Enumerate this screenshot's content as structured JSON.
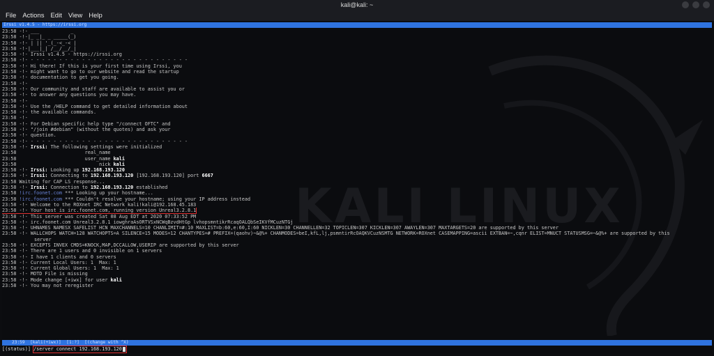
{
  "window": {
    "title": "kali@kali: ~"
  },
  "menu": {
    "file": "File",
    "actions": "Actions",
    "edit": "Edit",
    "view": "View",
    "help": "Help"
  },
  "topbar": {
    "text": "Irssi v1.4.5 - https://irssi.org"
  },
  "watermark": "KALI LINUX",
  "log": [
    {
      "t": "23:58 -!- ___           _"
    },
    {
      "t": "23:58 -!-|_ _|_ _ _____(_)"
    },
    {
      "t": "23:58 -!- | || '_(_-<_-< |"
    },
    {
      "t": "23:58 -!-|___|_| /__/__/_|"
    },
    {
      "t": "23:58 -!- Irssi v1.4.5 - https://irssi.org"
    },
    {
      "t": "23:58 -!- - - - - - - - - - - - - - - - - - - - - - - - - - - - -"
    },
    {
      "t": "23:58 -!- Hi there! If this is your first time using Irssi, you"
    },
    {
      "t": "23:58 -!- might want to go to our website and read the startup"
    },
    {
      "t": "23:58 -!- documentation to get you going."
    },
    {
      "t": "23:58 -!-"
    },
    {
      "t": "23:58 -!- Our community and staff are available to assist you or"
    },
    {
      "t": "23:58 -!- to answer any questions you may have."
    },
    {
      "t": "23:58 -!-"
    },
    {
      "t": "23:58 -!- Use the /HELP command to get detailed information about"
    },
    {
      "t": "23:58 -!- the available commands."
    },
    {
      "t": "23:58 -!-"
    },
    {
      "t": "23:58 -!- For Debian specific help type \"/connect OFTC\" and"
    },
    {
      "t": "23:58 -!- \"/join #debian\" (without the quotes) and ask your"
    },
    {
      "t": "23:58 -!- question."
    },
    {
      "t": "23:58 -!- - - - - - - - - - - - - - - - - - - - - - - - - - - - -"
    },
    {
      "p": "23:58 -!- ",
      "b": "Irssi:",
      "s": " The following settings were initialized"
    },
    {
      "t": "23:58                        real_name"
    },
    {
      "p": "23:58                        user_name ",
      "b": "kali",
      "s": ""
    },
    {
      "p": "23:58                             nick ",
      "b": "kali",
      "s": ""
    },
    {
      "p": "23:58 -!- ",
      "b": "Irssi:",
      "s": " Looking up ",
      "b2": "192.168.193.120",
      "s2": ""
    },
    {
      "p": "23:58 -!- ",
      "b": "Irssi:",
      "s": " Connecting to ",
      "b2": "192.168.193.120",
      "s2": " [192.168.193.120] port ",
      "b3": "6667"
    },
    {
      "t": "23:58 Waiting for CAP LS response..."
    },
    {
      "p": "23:58 -!- ",
      "b": "Irssi:",
      "s": " Connection to ",
      "b2": "192.168.193.120",
      "s2": " established"
    },
    {
      "p": "23:58 ",
      "blue": "!irc.foonet.com",
      "s": " *** Looking up your hostname..."
    },
    {
      "p": "23:58 ",
      "blue": "!irc.foonet.com",
      "s": " *** Couldn't resolve your hostname; using your IP address instead"
    },
    {
      "t": "23:58 -!- Welcome to the ROXnet IRC Network kali!kali@192.168.45.183"
    },
    {
      "t": "23:58 -!- Your host is irc.foonet.com, running version Unreal3.2.8.1",
      "hl": true
    },
    {
      "t": "23:58 -!- This server was created Sat 08 Aug EDT at 2020 07:33:52 PM"
    },
    {
      "t": "23:58 -!- irc.foonet.com Unreal3.2.8.1 iowghraAsORTVSxNCWqBzvdHtGp lvhopsmntikrRcaqOALQbSeIKVfMCuzNTGj"
    },
    {
      "t": "23:58 -!- UHNAMES NAMESX SAFELIST HCN MAXCHANNELS=10 CHANLIMIT=#:10 MAXLIST=b:60,e:60,I:60 NICKLEN=30 CHANNELLEN=32 TOPICLEN=307 KICKLEN=307 AWAYLEN=307 MAXTARGETS=20 are supported by this server"
    },
    {
      "t": "23:58 -!- WALLCHOPS WATCH=128 WATCHOPTS=A SILENCE=15 MODES=12 CHANTYPES=# PREFIX=(qaohv)~&@%+ CHANMODES=beI,kfL,lj,psmntirRcOAQKVCuzNSMTG NETWORK=ROXnet CASEMAPPING=ascii EXTBAN=~,cqnr ELIST=MNUCT STATUSMSG=~&@%+ are supported by this"
    },
    {
      "t": "server",
      "wrap": true
    },
    {
      "t": "23:58 -!- EXCEPTS INVEX CMDS=KNOCK,MAP,DCCALLOW,USERIP are supported by this server"
    },
    {
      "t": "23:58 -!- There are 1 users and 0 invisible on 1 servers"
    },
    {
      "t": "23:58 -!- I have 1 clients and 0 servers"
    },
    {
      "t": "23:58 -!- Current Local Users: 1  Max: 1"
    },
    {
      "t": "23:58 -!- Current Global Users: 1  Max: 1"
    },
    {
      "t": "23:58 -!- MOTD File is missing"
    },
    {
      "p": "23:58 -!- Mode change [+iwx] for user ",
      "b": "kali",
      "s": ""
    },
    {
      "t": "23:58 -!- You may not reregister"
    }
  ],
  "statusbar": {
    "text": "23:59  [kali(+iwx)]  [1:?]  [(change with ^X)"
  },
  "input": {
    "prompt": "[(status)] ",
    "value": "/server connect 192.168.193.120"
  }
}
